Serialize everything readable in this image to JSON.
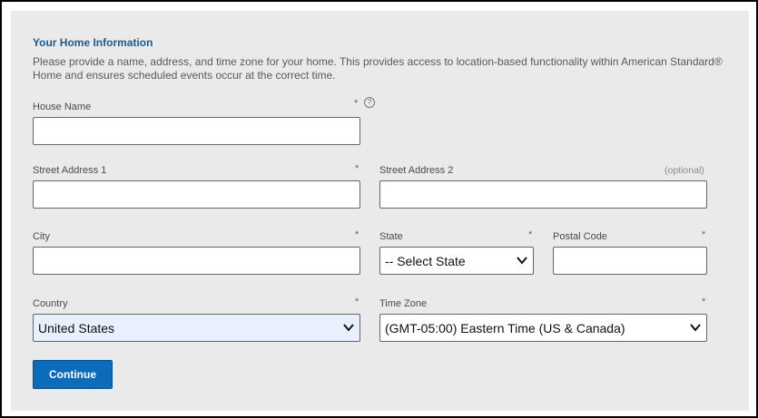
{
  "section": {
    "title": "Your Home Information",
    "description": "Please provide a name, address, and time zone for your home. This provides access to location-based functionality within American Standard® Home and ensures scheduled events occur at the correct time."
  },
  "fields": {
    "house_name": {
      "label": "House Name",
      "required": "*",
      "help": "?",
      "value": ""
    },
    "street1": {
      "label": "Street Address 1",
      "required": "*",
      "value": ""
    },
    "street2": {
      "label": "Street Address 2",
      "optional": "(optional)",
      "value": ""
    },
    "city": {
      "label": "City",
      "required": "*",
      "value": ""
    },
    "state": {
      "label": "State",
      "required": "*",
      "selected": "-- Select State"
    },
    "postal": {
      "label": "Postal Code",
      "required": "*",
      "value": ""
    },
    "country": {
      "label": "Country",
      "required": "*",
      "selected": "United States"
    },
    "timezone": {
      "label": "Time Zone",
      "required": "*",
      "selected": "(GMT-05:00) Eastern Time (US & Canada)"
    }
  },
  "actions": {
    "continue_label": "Continue"
  },
  "colors": {
    "accent": "#0b6cbb",
    "title": "#1f5a8c",
    "panel_bg": "#ebeaeb"
  }
}
